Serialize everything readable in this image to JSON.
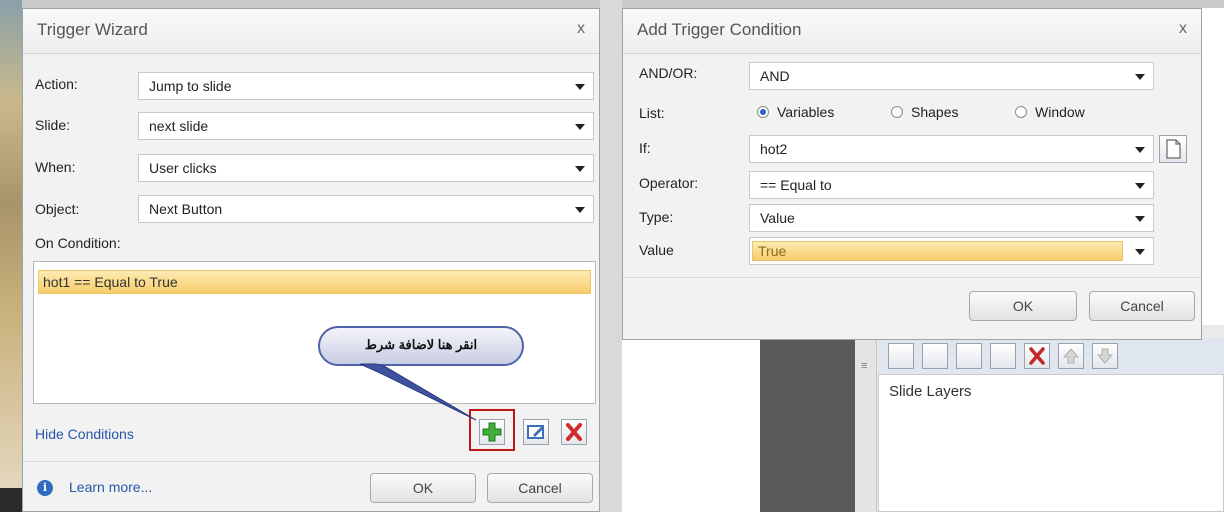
{
  "trigger_wizard": {
    "title": "Trigger Wizard",
    "close": "x",
    "action_label": "Action:",
    "action_value": "Jump to slide",
    "slide_label": "Slide:",
    "slide_value": "next slide",
    "when_label": "When:",
    "when_value": "User clicks",
    "object_label": "Object:",
    "object_value": "Next Button",
    "on_condition_label": "On Condition:",
    "conditions": [
      "hot1 == Equal to True"
    ],
    "hide_conditions": "Hide Conditions",
    "learn_more": "Learn more...",
    "info_icon_glyph": "i",
    "ok": "OK",
    "cancel": "Cancel"
  },
  "callout": {
    "text": "انقر هنا لاضافة شرط"
  },
  "add_condition": {
    "title": "Add Trigger Condition",
    "close": "x",
    "andor_label": "AND/OR:",
    "andor_value": "AND",
    "list_label": "List:",
    "list_options": [
      "Variables",
      "Shapes",
      "Window"
    ],
    "list_selected": "Variables",
    "if_label": "If:",
    "if_value": "hot2",
    "operator_label": "Operator:",
    "operator_value": "== Equal to",
    "type_label": "Type:",
    "type_value": "Value",
    "value_label": "Value",
    "value_value": "True",
    "ok": "OK",
    "cancel": "Cancel"
  },
  "slide_layers": {
    "title": "Slide Layers",
    "splitter_glyph": "≡"
  },
  "colors": {
    "highlight_box": "#c01818",
    "callout_border": "#4f62aa",
    "link": "#2457a8",
    "condition_highlight": "#f8cc6a"
  },
  "icons": [
    "add-condition-icon",
    "edit-condition-icon",
    "delete-condition-icon",
    "new-document-icon",
    "info-icon"
  ]
}
